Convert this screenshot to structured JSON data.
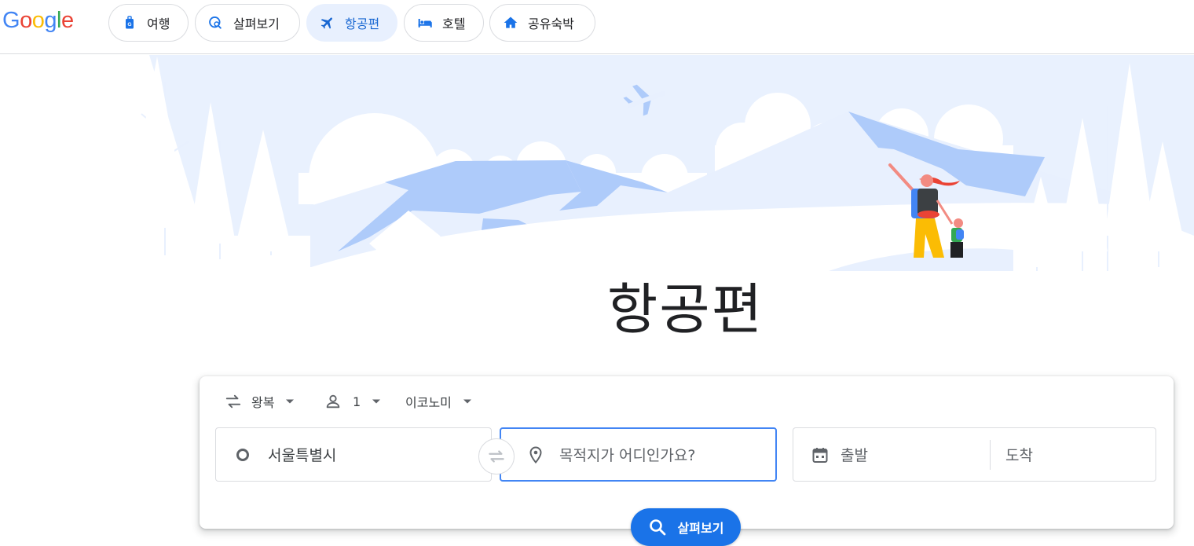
{
  "header": {
    "logo_letters": [
      {
        "ch": "G",
        "color": "#4285F4"
      },
      {
        "ch": "o",
        "color": "#EA4335"
      },
      {
        "ch": "o",
        "color": "#FBBC05"
      },
      {
        "ch": "g",
        "color": "#4285F4"
      },
      {
        "ch": "l",
        "color": "#34A853"
      },
      {
        "ch": "e",
        "color": "#EA4335"
      }
    ],
    "tabs": [
      {
        "label": "여행",
        "icon": "luggage-icon",
        "active": false
      },
      {
        "label": "살펴보기",
        "icon": "explore-icon",
        "active": false
      },
      {
        "label": "항공편",
        "icon": "flight-icon",
        "active": true
      },
      {
        "label": "호텔",
        "icon": "hotel-bed-icon",
        "active": false
      },
      {
        "label": "공유숙박",
        "icon": "home-icon",
        "active": false
      }
    ]
  },
  "main": {
    "title": "항공편"
  },
  "search": {
    "trip_type": "왕복",
    "passengers": "1",
    "cabin_class": "이코노미",
    "origin": "서울특별시",
    "destination_placeholder": "목적지가 어디인가요?",
    "depart_placeholder": "출발",
    "return_placeholder": "도착",
    "search_label": "살펴보기"
  },
  "colors": {
    "accent": "#1a73e8",
    "active_chip_bg": "#e8f0fe",
    "hero_light": "#e8f0fe",
    "hero_mid": "#aecbfa"
  }
}
